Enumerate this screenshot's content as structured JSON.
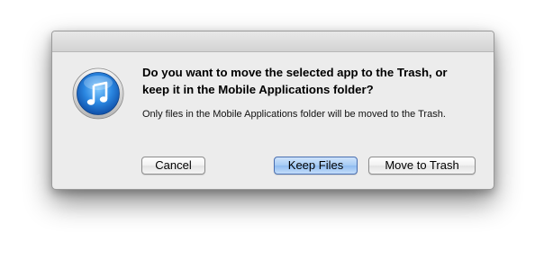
{
  "dialog": {
    "message": "Do you want to move the selected app to the Trash, or keep it in the Mobile Applications folder?",
    "informative_text": "Only files in the Mobile Applications folder will be moved to the Trash.",
    "icon": "itunes-icon"
  },
  "buttons": {
    "cancel_label": "Cancel",
    "keep_label": "Keep Files",
    "move_label": "Move to Trash"
  },
  "colors": {
    "default_button": "#a6cbf4",
    "dialog_background": "#ececec",
    "icon_blue": "#1d73d6"
  }
}
